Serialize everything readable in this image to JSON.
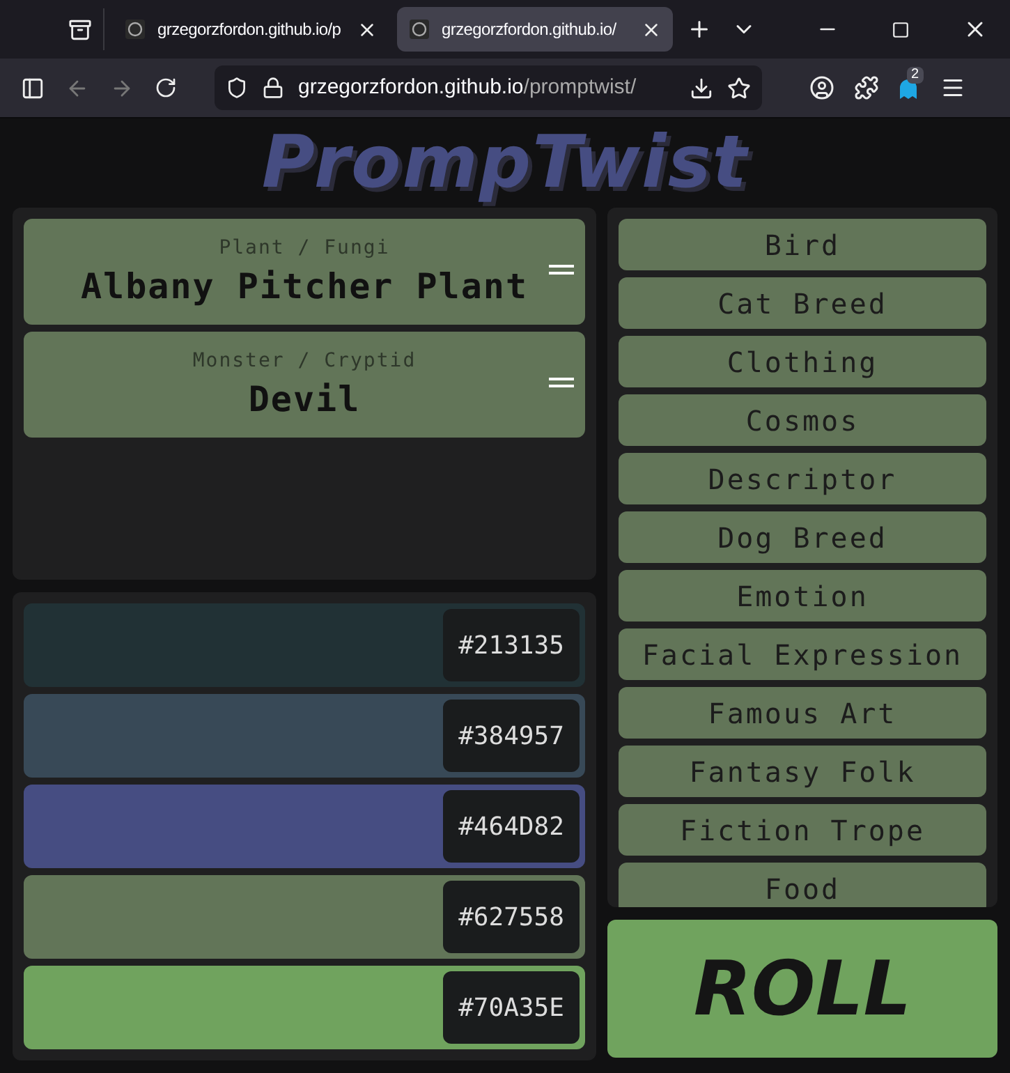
{
  "browser": {
    "tabs": [
      {
        "title": "grzegorzfordon.github.io/p",
        "selected": false
      },
      {
        "title": "grzegorzfordon.github.io/",
        "selected": true
      }
    ],
    "url_host": "grzegorzfordon.github.io",
    "url_path": "/promptwist/",
    "extensions_badge": "2"
  },
  "app_title": "PrompTwist",
  "prompts": [
    {
      "category": "Plant / Fungi",
      "value": "Albany Pitcher Plant"
    },
    {
      "category": "Monster / Cryptid",
      "value": "Devil"
    }
  ],
  "palette": [
    {
      "hex": "#213135",
      "color": "#213135"
    },
    {
      "hex": "#384957",
      "color": "#384957"
    },
    {
      "hex": "#464D82",
      "color": "#464d82"
    },
    {
      "hex": "#627558",
      "color": "#627558"
    },
    {
      "hex": "#70A35E",
      "color": "#70a35e"
    }
  ],
  "categories": [
    "Bird",
    "Cat Breed",
    "Clothing",
    "Cosmos",
    "Descriptor",
    "Dog Breed",
    "Emotion",
    "Facial Expression",
    "Famous Art",
    "Fantasy Folk",
    "Fiction Trope",
    "Food"
  ],
  "roll_button": "ROLL"
}
